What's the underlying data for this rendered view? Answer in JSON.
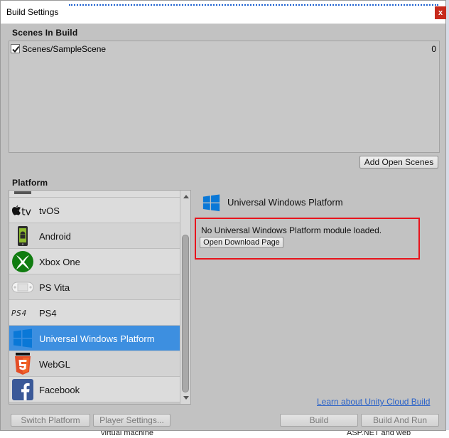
{
  "window": {
    "title": "Build Settings",
    "close_glyph": "x"
  },
  "scenes": {
    "section_label": "Scenes In Build",
    "items": [
      {
        "name": "Scenes/SampleScene",
        "index": "0",
        "checked": true
      }
    ],
    "add_open_scenes_label": "Add Open Scenes"
  },
  "platform": {
    "section_label": "Platform",
    "items": [
      {
        "label": "",
        "icon": "partial-platform-icon"
      },
      {
        "label": "tvOS",
        "icon": "apple-tv-icon"
      },
      {
        "label": "Android",
        "icon": "android-icon"
      },
      {
        "label": "Xbox One",
        "icon": "xbox-icon"
      },
      {
        "label": "PS Vita",
        "icon": "ps-vita-icon"
      },
      {
        "label": "PS4",
        "icon": "ps4-icon"
      },
      {
        "label": "Universal Windows Platform",
        "icon": "windows-icon",
        "selected": true
      },
      {
        "label": "WebGL",
        "icon": "html5-icon"
      },
      {
        "label": "Facebook",
        "icon": "facebook-icon"
      }
    ],
    "icon_text": {
      "tv": "tv",
      "ps4": "PS4"
    }
  },
  "details": {
    "title": "Universal Windows Platform",
    "module_message": "No Universal Windows Platform module loaded.",
    "open_download_label": "Open Download Page"
  },
  "footer": {
    "cloud_link": "Learn about Unity Cloud Build",
    "switch_platform_label": "Switch Platform",
    "player_settings_label": "Player Settings...",
    "build_label": "Build",
    "build_and_run_label": "Build And Run"
  },
  "background": {
    "left_text": "virtual machine",
    "right_text": "ASP.NET and web development"
  },
  "colors": {
    "selection": "#3d8fe0",
    "highlight_border": "#e8141c",
    "link": "#2a62c8",
    "windows_blue": "#0a78d7"
  }
}
